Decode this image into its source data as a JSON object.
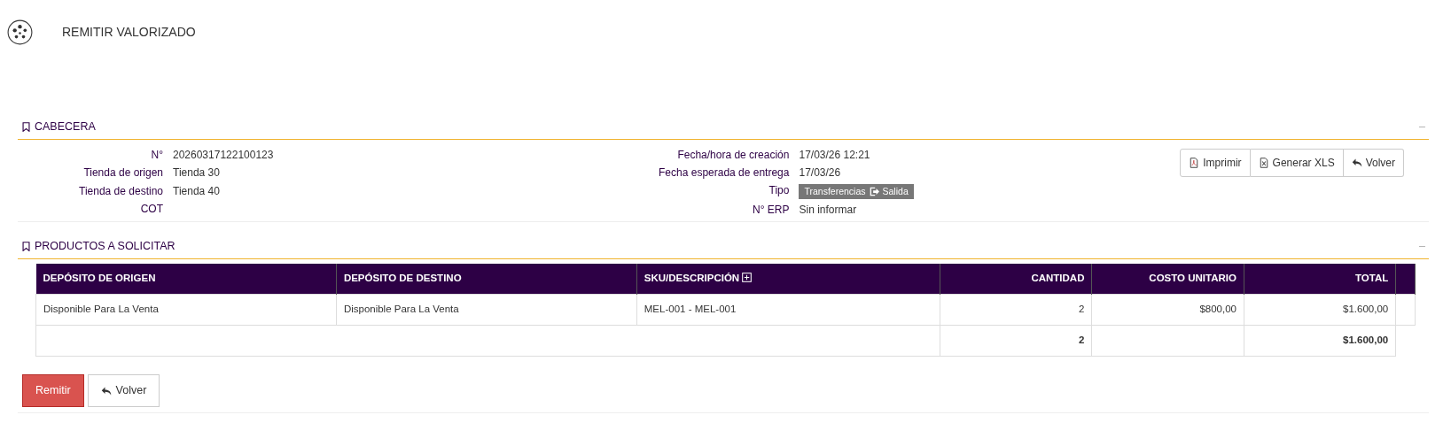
{
  "header": {
    "title": "REMITIR VALORIZADO"
  },
  "cabecera": {
    "title": "CABECERA",
    "collapse": "–",
    "fields_left": [
      {
        "label": "N°",
        "value": "20260317122100123",
        "kind": "text"
      },
      {
        "label": "Tienda de origen",
        "value": "Tienda 30",
        "kind": "text"
      },
      {
        "label": "Tienda de destino",
        "value": "Tienda 40",
        "kind": "text"
      },
      {
        "label": "COT",
        "kind": "text"
      }
    ],
    "fields_right": [
      {
        "label": "Fecha/hora de creación",
        "value": "17/03/26 12:21",
        "kind": "text"
      },
      {
        "label": "Fecha esperada de entrega",
        "value": "17/03/26",
        "kind": "text"
      },
      {
        "label": "Tipo",
        "kind": "badge",
        "badges": [
          "Transferencias",
          "Salida"
        ]
      },
      {
        "label": "N° ERP",
        "value": "Sin informar",
        "kind": "text"
      }
    ],
    "actions": [
      {
        "label": "Imprimir",
        "kind": "pdf"
      },
      {
        "label": "Generar XLS",
        "kind": "xls"
      },
      {
        "label": "Volver",
        "kind": "back"
      }
    ]
  },
  "productos": {
    "title": "PRODUCTOS A SOLICITAR",
    "collapse": "–",
    "table": {
      "columns": [
        {
          "label": "DEPÓSITO DE ORIGEN",
          "kind": "text"
        },
        {
          "label": "DEPÓSITO DE DESTINO",
          "kind": "text"
        },
        {
          "label": "SKU/DESCRIPCIÓN",
          "kind": "text",
          "expandable": true
        },
        {
          "label": "CANTIDAD",
          "kind": "number"
        },
        {
          "label": "COSTO UNITARIO",
          "kind": "number"
        },
        {
          "label": "TOTAL",
          "kind": "number"
        }
      ],
      "rows": [
        [
          "Disponible Para La Venta",
          "Disponible Para La Venta",
          "MEL-001 - MEL-001",
          "2",
          "$800,00",
          "$1.600,00"
        ]
      ],
      "totals": {
        "cantidad": "2",
        "total": "$1.600,00"
      }
    }
  },
  "footer_buttons": [
    {
      "label": "Remitir",
      "kind": "primary"
    },
    {
      "label": "Volver",
      "kind": "back"
    }
  ]
}
